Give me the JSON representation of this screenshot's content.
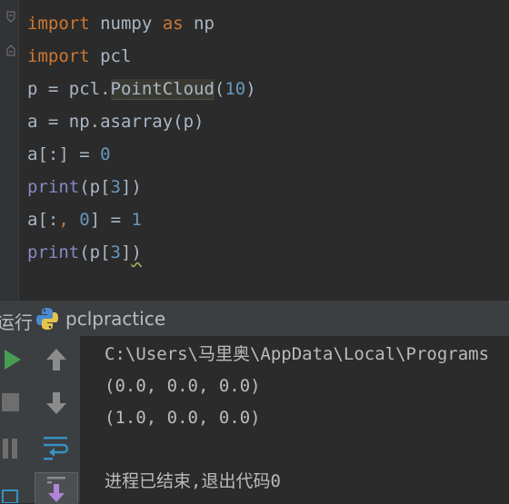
{
  "editor": {
    "lines": [
      {
        "kw1": "import",
        "rest1": " numpy ",
        "kw2": "as",
        "rest2": " np"
      },
      {
        "kw1": "import",
        "rest1": " pcl"
      },
      {
        "a": "p = pcl.",
        "hl": "PointCloud",
        "b": "(",
        "n": "10",
        "c": ")"
      },
      {
        "a": "a = np.asarray(p)"
      },
      {
        "a": "a[:] = ",
        "n": "0"
      },
      {
        "fn": "print",
        "a": "(p[",
        "n": "3",
        "b": "])"
      },
      {
        "a": "a[:",
        "k": ",",
        "b": " ",
        "n1": "0",
        "c": "] = ",
        "n2": "1"
      },
      {
        "fn": "print",
        "a": "(p[",
        "n": "3",
        "b": "]",
        "c": ")"
      }
    ]
  },
  "run": {
    "tab_label": "运行",
    "config_name": "pclpractice",
    "output": [
      "C:\\Users\\马里奥\\AppData\\Local\\Programs",
      "(0.0, 0.0, 0.0)",
      "(1.0, 0.0, 0.0)",
      "",
      "进程已结束,退出代码0"
    ]
  },
  "colors": {
    "background": "#2b2b2b",
    "keyword": "#cc7832",
    "number": "#6897bb",
    "builtin": "#8888c6",
    "text": "#a9b7c6",
    "run_green": "#499c54",
    "arrow_blue": "#3592c4"
  },
  "icons": [
    "fold-icon",
    "python-icon",
    "run-icon",
    "stop-icon",
    "pause-icon",
    "up-arrow-icon",
    "down-arrow-icon",
    "soft-wrap-icon",
    "scroll-to-end-icon"
  ]
}
